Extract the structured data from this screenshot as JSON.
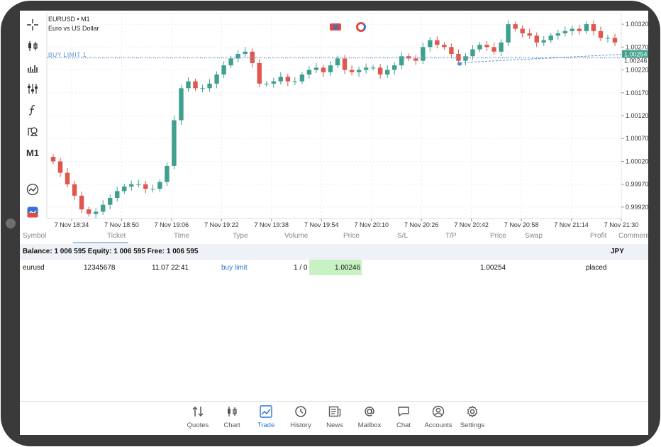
{
  "chart": {
    "symbol_line": "EURUSD • M1",
    "description": "Euro vs US Dollar",
    "order_line_label": "BUY LIMIT 1",
    "price_labels": [
      "1.00320",
      "1.00270",
      "1.00220",
      "1.00170",
      "1.00120",
      "1.00070",
      "1.00020",
      "0.99970",
      "0.99920"
    ],
    "current_price_a": "1.00254",
    "current_price_b": "1.00246",
    "time_labels": [
      "7 Nov 18:34",
      "7 Nov 18:50",
      "7 Nov 19:06",
      "7 Nov 19:22",
      "7 Nov 19:38",
      "7 Nov 19:54",
      "7 Nov 20:10",
      "7 Nov 20:26",
      "7 Nov 20:42",
      "7 Nov 20:58",
      "7 Nov 21:14",
      "7 Nov 21:30"
    ],
    "colors": {
      "bull": "#3fa08d",
      "bear": "#e0574f",
      "grid": "#eeeeee",
      "order_line": "#5b8fd6",
      "price_tag": "#3fa08d"
    }
  },
  "chart_data": {
    "type": "candlestick",
    "title": "EURUSD • M1",
    "subtitle": "Euro vs US Dollar",
    "y_range": [
      0.99895,
      1.00345
    ],
    "x_range": [
      "7 Nov 18:34",
      "7 Nov 21:30"
    ],
    "close_series": [
      1.0002,
      0.99995,
      0.9997,
      0.99945,
      0.99915,
      0.99905,
      0.9991,
      0.99925,
      0.9994,
      0.99955,
      0.99965,
      0.9997,
      0.9997,
      0.9996,
      0.9996,
      0.99975,
      1.0001,
      1.0011,
      1.0018,
      1.00195,
      1.0018,
      1.0018,
      1.0019,
      1.0021,
      1.0023,
      1.00245,
      1.00255,
      1.0026,
      1.00235,
      1.0019,
      1.0019,
      1.00195,
      1.00205,
      1.00195,
      1.00195,
      1.0021,
      1.0022,
      1.00225,
      1.00215,
      1.0023,
      1.00245,
      1.0022,
      1.00215,
      1.0022,
      1.00225,
      1.00225,
      1.0021,
      1.0022,
      1.0023,
      1.0025,
      1.00245,
      1.0024,
      1.0027,
      1.00285,
      1.00275,
      1.0027,
      1.00255,
      1.0024,
      1.0025,
      1.00265,
      1.00275,
      1.0027,
      1.0026,
      1.0028,
      1.0032,
      1.0031,
      1.003,
      1.00295,
      1.0028,
      1.00285,
      1.00295,
      1.003,
      1.00305,
      1.0031,
      1.00305,
      1.0032,
      1.00305,
      1.0029,
      1.0029,
      1.0028
    ],
    "pending_order": {
      "type": "buy limit",
      "price": 1.00246
    },
    "current_price": 1.00254
  },
  "toolbar": {
    "timeframe": "M1"
  },
  "table": {
    "headers": [
      "Symbol",
      "Ticket",
      "Time",
      "Type",
      "Volume",
      "Price",
      "S/L",
      "T/P",
      "Price",
      "Swap",
      "Profit",
      "Comment"
    ],
    "balance_line": "Balance: 1 006 595 Equity: 1 006 595 Free: 1 006 595",
    "currency": "JPY",
    "rows": [
      {
        "symbol": "eurusd",
        "ticket": "12345678",
        "time": "11.07 22:41",
        "type": "buy limit",
        "volume": "1 / 0",
        "price": "1.00246",
        "sl": "",
        "tp": "",
        "current_price": "1.00254",
        "swap": "",
        "profit": "placed",
        "comment": ""
      }
    ]
  },
  "nav": {
    "items": [
      {
        "label": "Quotes",
        "icon": "quotes-icon"
      },
      {
        "label": "Chart",
        "icon": "chart-icon"
      },
      {
        "label": "Trade",
        "icon": "trade-icon"
      },
      {
        "label": "History",
        "icon": "history-icon"
      },
      {
        "label": "News",
        "icon": "news-icon"
      },
      {
        "label": "Mailbox",
        "icon": "mailbox-icon"
      },
      {
        "label": "Chat",
        "icon": "chat-icon"
      },
      {
        "label": "Accounts",
        "icon": "accounts-icon"
      },
      {
        "label": "Settings",
        "icon": "settings-icon"
      }
    ],
    "active": "Trade"
  }
}
